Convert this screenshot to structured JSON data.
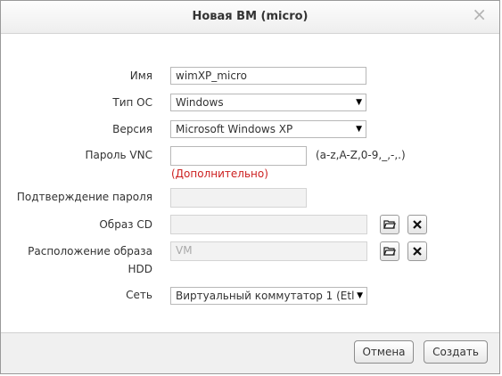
{
  "dialog": {
    "title": "Новая ВМ (micro)",
    "close_glyph": "×"
  },
  "form": {
    "name": {
      "label": "Имя",
      "value": "wimXP_micro"
    },
    "os_type": {
      "label": "Тип ОС",
      "value": "Windows"
    },
    "version": {
      "label": "Версия",
      "value": "Microsoft Windows XP"
    },
    "vnc_password": {
      "label": "Пароль VNC",
      "value": "",
      "hint": "(a-z,A-Z,0-9,_,-,.)",
      "optional": "(Дополнительно)"
    },
    "password_confirm": {
      "label": "Подтверждение пароля",
      "value": ""
    },
    "cd_image": {
      "label": "Образ CD",
      "value": ""
    },
    "hdd_location": {
      "label_line1": "Расположение образа",
      "label_line2": "HDD",
      "placeholder": "VM"
    },
    "network": {
      "label": "Сеть",
      "value": "Виртуальный коммутатор 1 (Etl"
    }
  },
  "footer": {
    "cancel_label": "Отмена",
    "create_label": "Создать"
  },
  "icons": {
    "dropdown": "dropdown-arrow-icon",
    "browse": "folder-icon",
    "clear": "close-x-icon"
  }
}
